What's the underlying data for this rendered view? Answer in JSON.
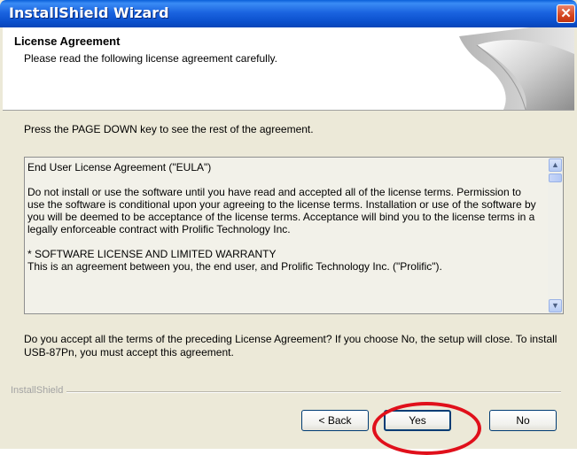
{
  "window": {
    "title": "InstallShield Wizard",
    "close_glyph": "✕"
  },
  "header": {
    "title": "License Agreement",
    "subtitle": "Please read the following license agreement carefully."
  },
  "body": {
    "hint": "Press the PAGE DOWN key to see the rest of the agreement.",
    "eula_text": "End User License Agreement (\"EULA\")\n\nDo not install or use the software until you have read and accepted all of the license terms. Permission to use the software is conditional upon your agreeing to the license terms. Installation or use of the software by you will be deemed to be acceptance of the license terms. Acceptance will bind you to the license terms in a legally enforceable contract with Prolific Technology Inc.\n\n* SOFTWARE LICENSE AND LIMITED WARRANTY\nThis is an agreement between you, the end user, and Prolific Technology Inc. (\"Prolific\").",
    "question": "Do you accept all the terms of the preceding License Agreement?  If you choose No,  the setup will close.  To install USB-87Pn, you must accept this agreement."
  },
  "footer": {
    "brand": "InstallShield"
  },
  "buttons": {
    "back": "< Back",
    "yes": "Yes",
    "no": "No"
  },
  "icons": {
    "scroll_up": "scroll-up-arrow-icon",
    "scroll_down": "scroll-down-arrow-icon",
    "close": "close-icon"
  },
  "colors": {
    "titlebar": "#0a4fcc",
    "highlight_circle": "#e0101b"
  }
}
